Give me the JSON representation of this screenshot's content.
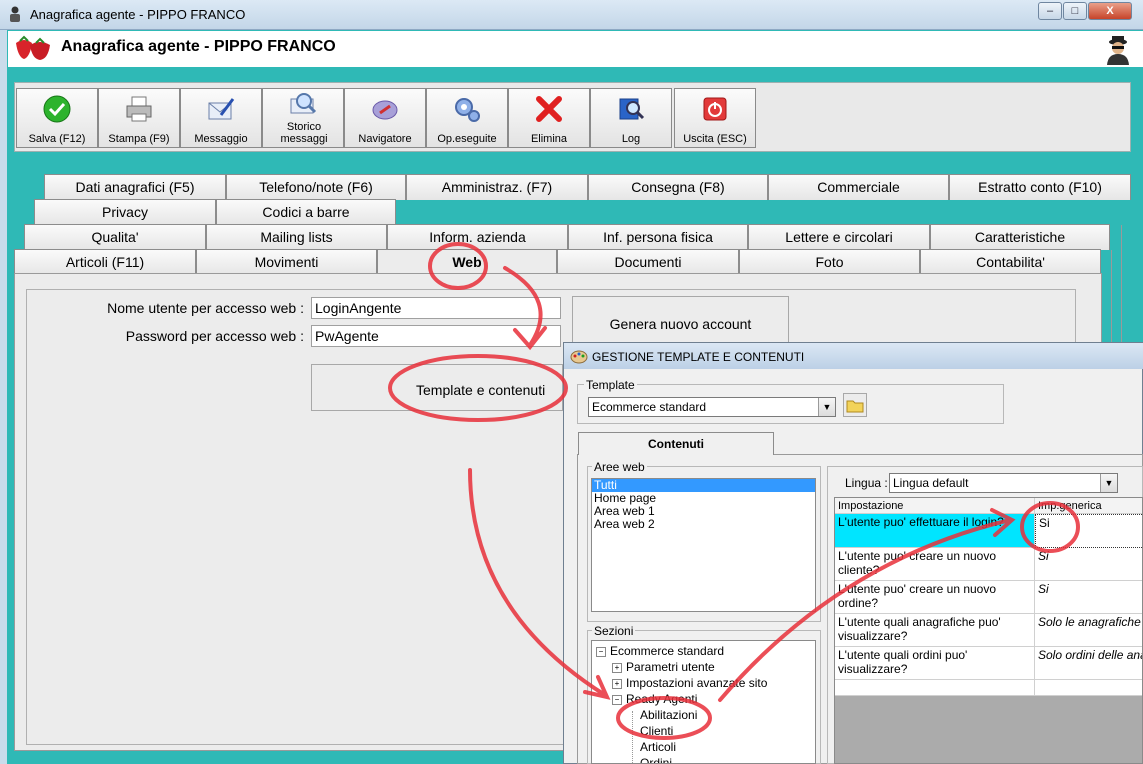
{
  "window": {
    "title": "Anagrafica agente - PIPPO FRANCO",
    "min": "–",
    "max": "□",
    "close": "X"
  },
  "header": {
    "title": "Anagrafica agente - PIPPO FRANCO"
  },
  "toolbar": [
    {
      "label": "Salva (F12)",
      "icon": "checkmark-icon"
    },
    {
      "label": "Stampa (F9)",
      "icon": "printer-icon"
    },
    {
      "label": "Messaggio",
      "icon": "envelope-pen-icon"
    },
    {
      "label": "Storico messaggi",
      "icon": "envelope-search-icon"
    },
    {
      "label": "Navigatore",
      "icon": "compass-icon"
    },
    {
      "label": "Op.eseguite",
      "icon": "gears-icon"
    },
    {
      "label": "Elimina",
      "icon": "red-x-icon"
    },
    {
      "label": "Log",
      "icon": "book-search-icon"
    },
    {
      "label": "Uscita (ESC)",
      "icon": "power-icon"
    }
  ],
  "tabs": {
    "row1": [
      "Dati anagrafici (F5)",
      "Telefono/note (F6)",
      "Amministraz. (F7)",
      "Consegna (F8)",
      "Commerciale",
      "Estratto conto (F10)"
    ],
    "row2": [
      "Privacy",
      "Codici a barre"
    ],
    "row3": [
      "Qualita'",
      "Mailing lists",
      "Inform. azienda",
      "Inf. persona fisica",
      "Lettere e circolari",
      "Caratteristiche"
    ],
    "row4": [
      "Articoli (F11)",
      "Movimenti",
      "Web",
      "Documenti",
      "Foto",
      "Contabilita'"
    ],
    "active": "Web"
  },
  "web": {
    "username_label": "Nome utente per accesso web :",
    "username_value": "LoginAngente",
    "password_label": "Password per accesso web :",
    "password_value": "PwAgente",
    "generate_button": "Genera nuovo account",
    "template_button": "Template e contenuti"
  },
  "dialog": {
    "title": "GESTIONE TEMPLATE E CONTENUTI",
    "template_group": "Template",
    "template_value": "Ecommerce standard",
    "tab_contenuti": "Contenuti",
    "aree_group": "Aree web",
    "aree": [
      "Tutti",
      "Home page",
      "Area web 1",
      "Area web 2"
    ],
    "aree_selected": "Tutti",
    "lingua_label": "Lingua :",
    "lingua_value": "Lingua default",
    "grid_headers": [
      "Impostazione",
      "Imp.generica"
    ],
    "grid_rows": [
      {
        "setting": "L'utente puo' effettuare il login?",
        "value": "Si"
      },
      {
        "setting": "L'utente puo' creare un nuovo cliente?",
        "value": "Si"
      },
      {
        "setting": "L'utente puo' creare un nuovo ordine?",
        "value": "Si"
      },
      {
        "setting": "L'utente quali anagrafiche puo' visualizzare?",
        "value": "Solo le anagrafiche di"
      },
      {
        "setting": "L'utente quali ordini puo' visualizzare?",
        "value": "Solo ordini delle anag"
      }
    ],
    "sezioni_group": "Sezioni",
    "tree": [
      {
        "label": "Ecommerce standard",
        "pm": "−",
        "level": 0
      },
      {
        "label": "Parametri utente",
        "pm": "+",
        "level": 1
      },
      {
        "label": "Impostazioni avanzate sito",
        "pm": "+",
        "level": 1
      },
      {
        "label": "Ready Agenti",
        "pm": "−",
        "level": 1
      },
      {
        "label": "Abilitazioni",
        "pm": "",
        "level": 2
      },
      {
        "label": "Clienti",
        "pm": "",
        "level": 2
      },
      {
        "label": "Articoli",
        "pm": "",
        "level": 2
      },
      {
        "label": "Ordini",
        "pm": "",
        "level": 2
      }
    ]
  },
  "colors": {
    "frame": "#2fb9b6",
    "highlight_cell": "#00e5ff",
    "annotation": "#e8303a"
  }
}
